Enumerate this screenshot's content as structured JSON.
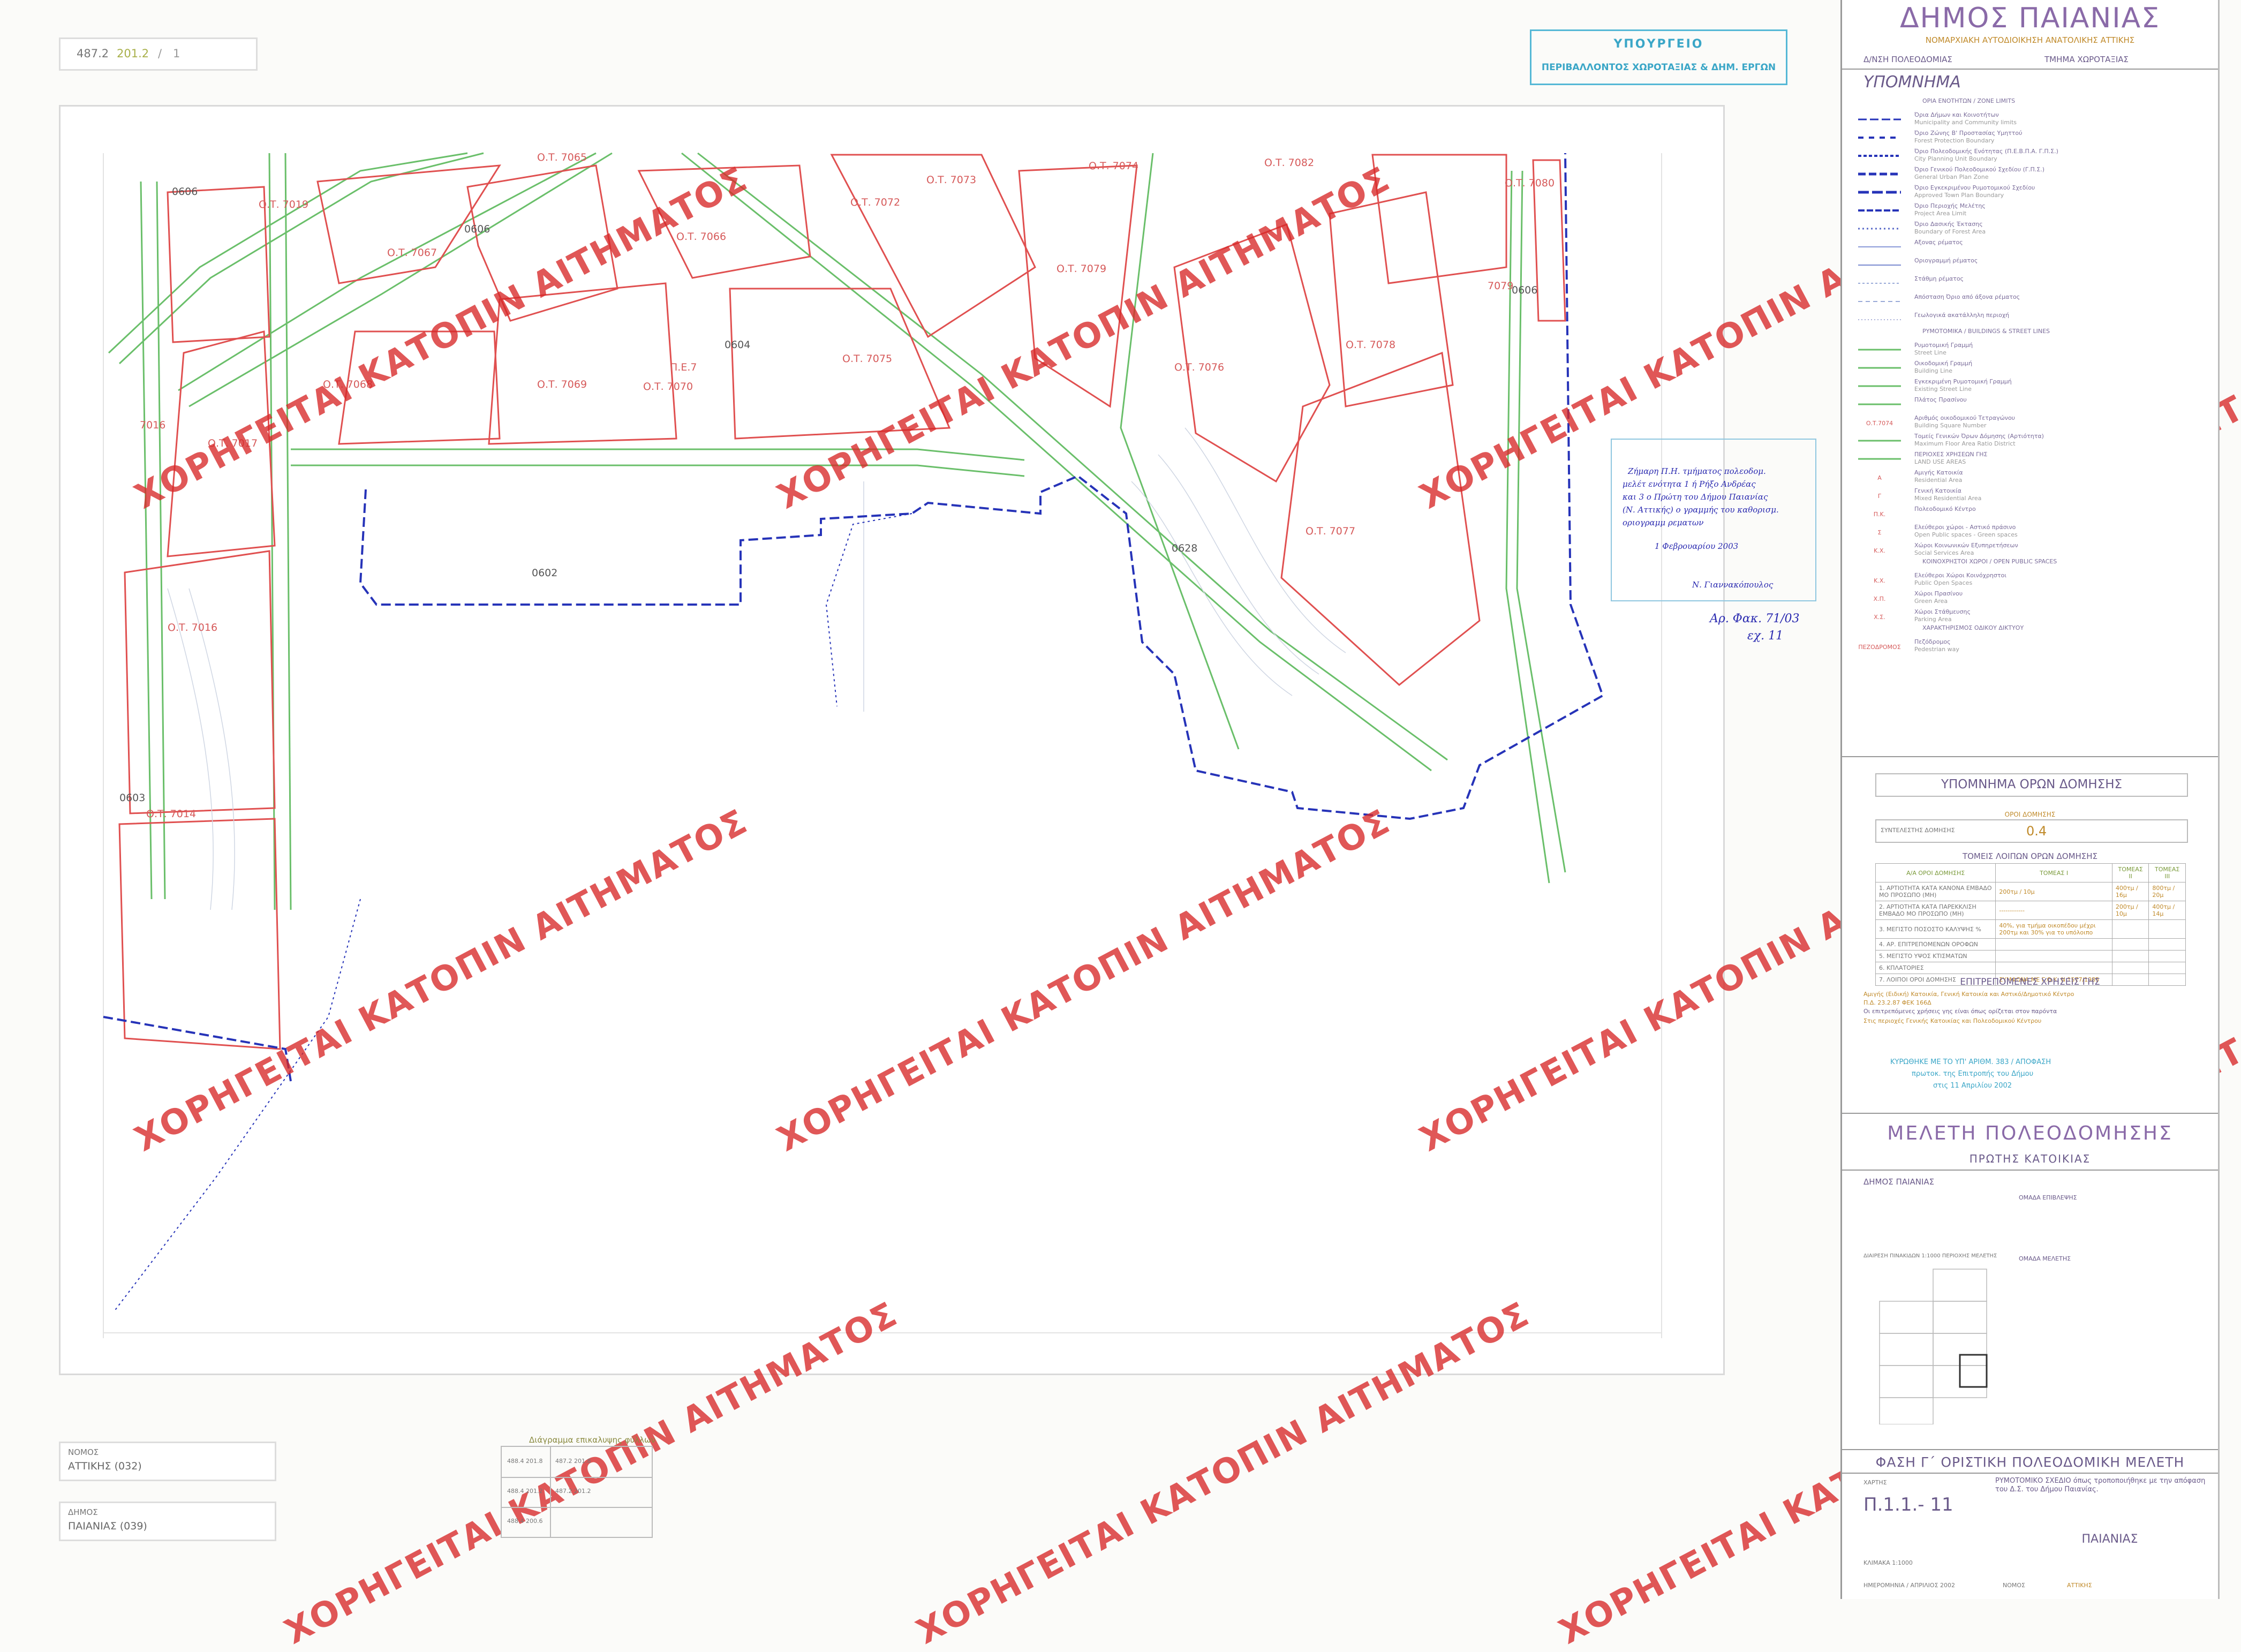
{
  "sheet_ref": {
    "a": "487.2",
    "b": "201.2",
    "sep": "/",
    "c": "1"
  },
  "stamp_ministry": {
    "line1": "ΥΠΟΥΡΓΕΙΟ",
    "line2": "ΠΕΡΙΒΑΛΛΟΝΤΟΣ ΧΩΡΟΤΑΞΙΑΣ & ΔΗΜ. ΕΡΓΩΝ"
  },
  "watermark": "ΧΟΡΗΓΕΙΤΑΙ ΚΑΤΟΠΙΝ ΑΙΤΗΜΑΤΟΣ",
  "blocks": [
    "Ο.Τ. 7065",
    "Ο.Τ. 7019",
    "Ο.Τ. 7066",
    "Ο.Τ. 7067",
    "Ο.Τ. 7072",
    "Ο.Τ. 7073",
    "Ο.Τ. 7074",
    "Ο.Τ. 7082",
    "Ο.Τ. 7079",
    "Ο.Τ. 7080",
    "Ο.Τ. 7076",
    "Ο.Τ. 7075",
    "Ο.Τ. 7078",
    "Ο.Τ. 7077",
    "Ο.Τ. 7068",
    "Ο.Τ. 7069",
    "Ο.Τ. 7070",
    "Ο.Τ. 7017",
    "Ο.Τ. 7016",
    "Ο.Τ. 7014",
    "Π.Ε.7",
    "7016",
    "7079"
  ],
  "zones": [
    "0606",
    "0606",
    "0604",
    "0602",
    "0628",
    "0603",
    "0606"
  ],
  "handnote": {
    "lines": [
      "Ζήμαρη Π.Η. τμήματος πολεοδομ.",
      "μελέτ ενότητα 1 ή Ρήξο Ανδρέας",
      "και 3 ο Πρώτη του Δήμου Παιανίας",
      "(Ν. Αττικής) ο γραμμής του καθορισμ.",
      "οριογραμμ ρεματων"
    ],
    "date": "1 Φεβρουαρίου 2003",
    "sig": "Ν. Γιαννακόπουλος",
    "ref1": "Αρ. Φακ. 71/03",
    "ref2": "εχ. 11"
  },
  "bottom_left": {
    "nomos_label": "ΝΟΜΟΣ",
    "nomos_value": "ΑΤΤΙΚΗΣ (032)",
    "dimos_label": "ΔΗΜΟΣ",
    "dimos_value": "ΠΑΙΑΝΙΑΣ (039)"
  },
  "adjacent_sheets": {
    "title": "Διάγραμμα επικαλυψης φύλλων",
    "rows": [
      [
        "488.4 201.8",
        "487.2 201.8"
      ],
      [
        "488.4 201.2",
        "487.2 201.2"
      ],
      [
        "488.4 200.6",
        ""
      ]
    ]
  },
  "panel": {
    "title": "ΔΗΜΟΣ ΠΑΙΑΝΙΑΣ",
    "subtitle": "ΝΟΜΑΡΧΙΑΚΗ ΑΥΤΟΔΙΟΙΚΗΣΗ ΑΝΑΤΟΛΙΚΗΣ ΑΤΤΙΚΗΣ",
    "dept1": "Δ/ΝΣΗ ΠΟΛΕΟΔΟΜΙΑΣ",
    "dept2": "ΤΜΗΜΑ ΧΩΡΟΤΑΞΙΑΣ",
    "legend_title": "ΥΠΟΜΝΗΜΑ",
    "legend_sec1": "ΟΡΙΑ ΕΝΟΤΗΤΩΝ / ZONE LIMITS",
    "legend_items": [
      [
        "Όρια Δήμων και Κοινοτήτων",
        "Municipality and Community limits"
      ],
      [
        "Όριο Ζώνης Β' Προστασίας Υμηττού",
        "Forest Protection Boundary"
      ],
      [
        "Όριο Πολεοδομικής Ενότητας (Π.Ε.Β.Π.Α. Γ.Π.Σ.)",
        "City Planning Unit Boundary"
      ],
      [
        "Όριο Γενικού Πολεοδομικού Σχεδίου (Γ.Π.Σ.)",
        "General Urban Plan Zone"
      ],
      [
        "Όριο Εγκεκριμένου Ρυμοτομικού Σχεδίου",
        "Approved Town Plan Boundary"
      ],
      [
        "Όριο Περιοχής Μελέτης",
        "Project Area Limit"
      ],
      [
        "Όριο Δασικής Έκτασης",
        "Boundary of Forest Area"
      ],
      [
        "Αξονας ρέματος",
        ""
      ],
      [
        "Οριογραμμή ρέματος",
        ""
      ],
      [
        "Στάθμη ρέματος",
        ""
      ],
      [
        "Απόσταση Όριο από άξονα ρέματος",
        ""
      ],
      [
        "Γεωλογικά ακατάλληλη περιοχή",
        ""
      ]
    ],
    "legend_sec2": "ΡΥΜΟΤΟΜΙΚΑ / BUILDINGS & STREET LINES",
    "legend_items2": [
      [
        "Ρυμοτομική Γραμμή",
        "Street Line"
      ],
      [
        "Οικοδομική Γραμμή",
        "Building Line"
      ],
      [
        "Εγκεκριμένη Ρυμοτομική Γραμμή",
        "Existing Street Line"
      ],
      [
        "Πλάτος Πρασίνου",
        ""
      ],
      [
        "Αριθμός οικοδομικού Τετραγώνου",
        "Building Square Number"
      ],
      [
        "Τομείς Γενικών Όρων Δόμησης (Αρτιότητα)",
        "Maximum Floor Area Ratio District"
      ],
      [
        "ΠΕΡΙΟΧΕΣ ΧΡΗΣΕΩΝ ΓΗΣ",
        "LAND USE AREAS"
      ],
      [
        "Αμιγής Κατοικία",
        "Residential Area"
      ],
      [
        "Γενική Κατοικία",
        "Mixed Residential Area"
      ],
      [
        "Πολεοδομικό Κέντρο",
        ""
      ],
      [
        "Ελεύθεροι χώροι - Αστικό πράσινο",
        "Open Public spaces - Green spaces"
      ],
      [
        "Χώροι Κοινωνικών Εξυπηρετήσεων",
        "Social Services Area"
      ]
    ],
    "legend_sec3": "ΚΟΙΝΟΧΡΗΣΤΟΙ ΧΩΡΟΙ / OPEN PUBLIC SPACES",
    "legend_items3": [
      [
        "Ελεύθεροι Χώροι Κοινόχρηστοι",
        "Public Open Spaces"
      ],
      [
        "Χώροι Πρασίνου",
        "Green Area"
      ],
      [
        "Χώροι Στάθμευσης",
        "Parking Area"
      ]
    ],
    "legend_sec4": "ΧΑΡΑΚΤΗΡΙΣΜΟΣ ΟΔΙΚΟΥ ΔΙΚΤΥΟΥ",
    "legend_items4": [
      [
        "Πεζόδρομος",
        "Pedestrian way"
      ]
    ],
    "legend_codes": [
      "Ο.Τ.7074",
      "Α",
      "Γ",
      "Π.Κ.",
      "Σ",
      "Κ.Χ.",
      "Κ.Χ.",
      "Χ.Π.",
      "Χ.Σ.",
      "ΠΕΖΟΔΡΟΜΟΣ"
    ],
    "terms_title": "ΥΠΟΜΝΗΜΑ ΟΡΩΝ ΔΟΜΗΣΗΣ",
    "terms_sub": "ΟΡΟΙ ΔΟΜΗΣΗΣ",
    "far_label": "ΣΥΝΤΕΛΕΣΤΗΣ ΔΟΜΗΣΗΣ",
    "far_value": "0.4",
    "sectors_title": "ΤΟΜΕΙΣ ΛΟΙΠΩΝ ΟΡΩΝ ΔΟΜΗΣΗΣ",
    "sectors_table": {
      "head": [
        "Α/Α ΟΡΟΙ ΔΟΜΗΣΗΣ",
        "ΤΟΜΕΑΣ Ι",
        "ΤΟΜΕΑΣ ΙΙ",
        "ΤΟΜΕΑΣ ΙΙΙ"
      ],
      "rows": [
        [
          "1. ΑΡΤΙΟΤΗΤΑ ΚΑΤΑ ΚΑΝΟΝΑ ΕΜΒΑΔΟ ΜΟ ΠΡΟΣΩΠΟ (ΜΗ)",
          "200τμ / 10μ",
          "400τμ / 16μ",
          "800τμ / 20μ"
        ],
        [
          "2. ΑΡΤΙΟΤΗΤΑ ΚΑΤΑ ΠΑΡΕΚΚΛΙΣΗ ΕΜΒΑΔΟ ΜΟ ΠΡΟΣΩΠΟ (ΜΗ)",
          "------------",
          "200τμ / 10μ",
          "400τμ / 14μ"
        ],
        [
          "3. ΜΕΓΙΣΤΟ ΠΟΣΟΣΤΟ ΚΑΛΥΨΗΣ %",
          "40%, για τμήμα οικοπέδου μέχρι 200τμ και 30% για το υπόλοιπο",
          "",
          ""
        ],
        [
          "4. ΑΡ. ΕΠΙΤΡΕΠΟΜΕΝΩΝ ΟΡΟΦΩΝ",
          "",
          "",
          ""
        ],
        [
          "5. ΜΕΓΙΣΤΟ ΥΨΟΣ ΚΤΙΣΜΑΤΩΝ",
          "",
          "",
          ""
        ],
        [
          "6. ΚΠΛΑΤΟΡΙΕΣ",
          "",
          "",
          ""
        ],
        [
          "7. ΛΟΙΠΟΙ ΟΡΟΙ ΔΟΜΗΣΗΣ",
          "ΣΥΜΦΩΝΑ ΜΕ Γ.Ο.Κ. Ν.1577/1985",
          "",
          ""
        ]
      ]
    },
    "uses_title": "ΕΠΙΤΡΕΠΟΜΕΝΕΣ ΧΡΗΣΕΙΣ ΓΗΣ",
    "uses_lines": [
      "Αμιγής (Ειδική) Κατοικία, Γενική Κατοικία και Αστικό/Δημοτικό Κέντρο",
      "Π.Δ. 23.2.87 ΦΕΚ 166Δ",
      "Οι επιτρεπόμενες χρήσεις γης είναι όπως ορίζεται στον παρόντα",
      "Στις περιοχές Γενικής Κατοικίας και Πολεοδομικού Κέντρου"
    ],
    "approval": "ΚΥΡΩΘΗΚΕ ΜΕ ΤΟ ΥΠ' ΑΡΙΘΜ. 383 / ΑΠΟΦΑΣΗ",
    "approval2": "πρωτοκ. της Επιτροπής του Δήμου",
    "approval3": "στις 11 Απριλίου 2002",
    "study_title": "ΜΕΛΕΤΗ ΠΟΛΕΟΔΟΜΗΣΗΣ",
    "study_sub": "ΠΡΩΤΗΣ ΚΑΤΟΙΚΙΑΣ",
    "study_dimos": "ΔΗΜΟΣ ΠΑΙΑΝΙΑΣ",
    "team_label": "ΟΜΑΔΑ ΕΠΙΒΛΕΨΗΣ",
    "team2_label": "ΟΜΑΔΑ ΜΕΛΕΤΗΣ",
    "grid_title": "ΔΙΑΙΡΕΣΗ ΠΙΝΑΚΙΔΩΝ 1:1000 ΠΕΡΙΟΧΗΣ ΜΕΛΕΤΗΣ",
    "phase": "ΦΑΣΗ Γ΄ ΟΡΙΣΤΙΚΗ ΠΟΛΕΟΔΟΜΙΚΗ ΜΕΛΕΤΗ",
    "map_label": "ΧΑΡΤΗΣ",
    "map_number": "Π.1.1.- 11",
    "map_desc": "ΡΥΜΟΤΟΜΙΚΟ ΣΧΕΔΙΟ όπως τροποποιήθηκε με την απόφαση του Δ.Σ. του Δήμου Παιανίας.",
    "scale": "ΚΛΙΜΑΚΑ 1:1000",
    "date": "ΗΜΕΡΟΜΗΝΙΑ / ΑΠΡΙΛΙΟΣ 2002",
    "place": "ΠΑΙΑΝΙΑΣ",
    "nomos_small": "ΝΟΜΟΣ",
    "nomos_small_v": "ΑΤΤΙΚΗΣ"
  }
}
